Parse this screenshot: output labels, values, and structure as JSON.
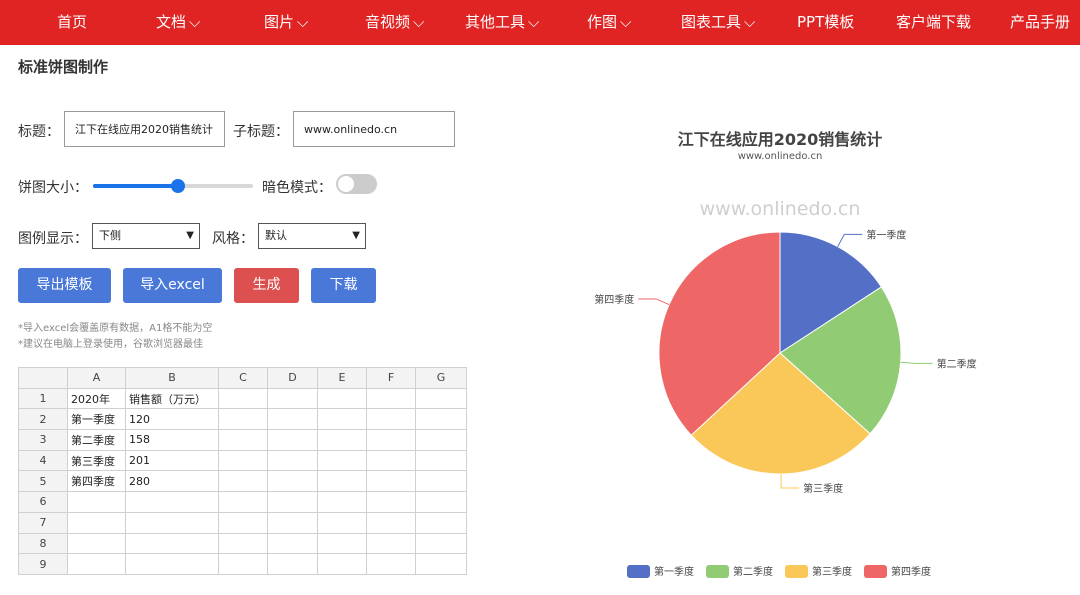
{
  "nav": {
    "items": [
      {
        "label": "首页",
        "dropdown": false
      },
      {
        "label": "文档",
        "dropdown": true
      },
      {
        "label": "图片",
        "dropdown": true
      },
      {
        "label": "音视频",
        "dropdown": true
      },
      {
        "label": "其他工具",
        "dropdown": true
      },
      {
        "label": "作图",
        "dropdown": true
      },
      {
        "label": "图表工具",
        "dropdown": true
      },
      {
        "label": "PPT模板",
        "dropdown": false
      },
      {
        "label": "客户端下载",
        "dropdown": false
      },
      {
        "label": "产品手册",
        "dropdown": false
      }
    ],
    "bg_color": "#e02424"
  },
  "page": {
    "title": "标准饼图制作"
  },
  "form": {
    "title_label": "标题：",
    "title_value": "江下在线应用2020销售统计",
    "subtitle_label": "子标题：",
    "subtitle_value": "www.onlinedo.cn",
    "size_label": "饼图大小：",
    "size_slider_level": 0.53,
    "dark_label": "暗色模式：",
    "dark_mode": false,
    "legend_label": "图例显示：",
    "legend_value": "下侧",
    "style_label": "风格：",
    "style_value": "默认"
  },
  "buttons": {
    "export_template": "导出模板",
    "import_excel": "导入excel",
    "generate": "生成",
    "download": "下载"
  },
  "notes": [
    "*导入excel会覆盖原有数据，A1格不能为空",
    "*建议在电脑上登录使用，谷歌浏览器最佳"
  ],
  "sheet": {
    "columns": [
      "A",
      "B",
      "C",
      "D",
      "E",
      "F",
      "G"
    ],
    "rows": [
      [
        "1",
        "2020年",
        "销售额（万元）"
      ],
      [
        "2",
        "第一季度",
        "120"
      ],
      [
        "3",
        "第二季度",
        "158"
      ],
      [
        "4",
        "第三季度",
        "201"
      ],
      [
        "5",
        "第四季度",
        "280"
      ],
      [
        "6",
        "",
        ""
      ],
      [
        "7",
        "",
        ""
      ],
      [
        "8",
        "",
        ""
      ],
      [
        "9",
        "",
        ""
      ]
    ]
  },
  "watermark": "www.onlinedo.cn",
  "chart_data": {
    "type": "pie",
    "title": "江下在线应用2020销售统计",
    "subtitle": "www.onlinedo.cn",
    "categories": [
      "第一季度",
      "第二季度",
      "第三季度",
      "第四季度"
    ],
    "values": [
      120,
      158,
      201,
      280
    ],
    "colors": [
      "#5470c6",
      "#91cc75",
      "#fac858",
      "#ee6666"
    ],
    "legend_position": "bottom"
  }
}
